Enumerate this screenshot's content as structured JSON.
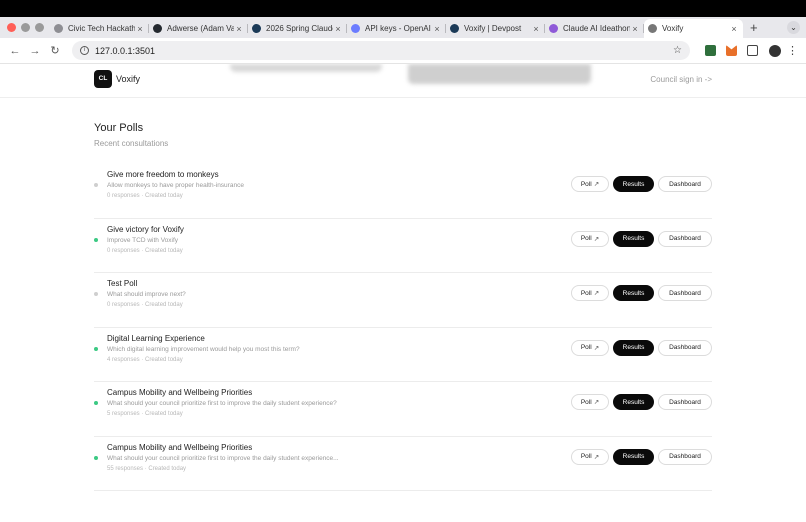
{
  "browser": {
    "tabs": [
      {
        "label": "Civic Tech Hackath",
        "icon": "globe-icon",
        "color": "#8e8e93"
      },
      {
        "label": "Adwerse (Adam Va",
        "icon": "github-icon",
        "color": "#24292f"
      },
      {
        "label": "2026 Spring Claude",
        "icon": "devpost-icon",
        "color": "#1b3a57"
      },
      {
        "label": "API keys - OpenAI",
        "icon": "openai-icon",
        "color": "#6b7cff"
      },
      {
        "label": "Voxify | Devpost",
        "icon": "devpost-icon",
        "color": "#1b3a57"
      },
      {
        "label": "Claude AI Ideathon",
        "icon": "claude-icon",
        "color": "#8f5ad8"
      },
      {
        "label": "Voxify",
        "icon": "globe-icon",
        "color": "#777777"
      }
    ],
    "tab_close": "×",
    "new_tab": "+",
    "tab_menu": "⌄",
    "url": "127.0.0.1:3501"
  },
  "site": {
    "logo_text": "CL",
    "brand": "Voxify",
    "signin": "Council sign in ->"
  },
  "main": {
    "title": "Your Polls",
    "subtitle": "Recent consultations",
    "buttons": {
      "poll": "Poll",
      "results": "Results",
      "dashboard": "Dashboard"
    },
    "polls": [
      {
        "name": "Give more freedom to monkeys",
        "desc": "Allow monkeys to have proper health-insurance",
        "meta": "0 responses · Created today",
        "status": "grey"
      },
      {
        "name": "Give victory for Voxify",
        "desc": "Improve TCD with Voxify",
        "meta": "0 responses · Created today",
        "status": "green"
      },
      {
        "name": "Test Poll",
        "desc": "What should improve next?",
        "meta": "0 responses · Created today",
        "status": "grey"
      },
      {
        "name": "Digital Learning Experience",
        "desc": "Which digital learning improvement would help you most this term?",
        "meta": "4 responses · Created today",
        "status": "green"
      },
      {
        "name": "Campus Mobility and Wellbeing Priorities",
        "desc": "What should your council prioritize first to improve the daily student experience?",
        "meta": "5 responses · Created today",
        "status": "green"
      },
      {
        "name": "Campus Mobility and Wellbeing Priorities",
        "desc": "What should your council prioritize first to improve the daily student experience...",
        "meta": "55 responses · Created today",
        "status": "green"
      }
    ]
  }
}
